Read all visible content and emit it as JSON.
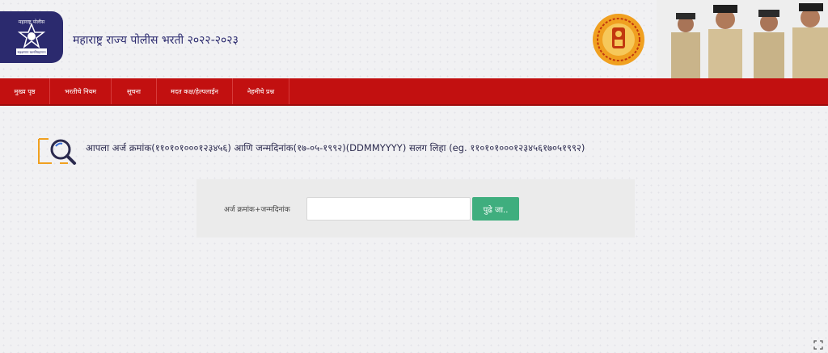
{
  "header": {
    "site_title": "महाराष्ट्र राज्य पोलीस भरती २०२२-२०२३",
    "logo_text_top": "महाराष्ट्र पोलीस",
    "logo_text_bottom": "सद्रक्षणाय खलनिग्रहणाय"
  },
  "nav": {
    "items": [
      {
        "label": "मुख्य पृष्ठ"
      },
      {
        "label": "भरतीचे नियम"
      },
      {
        "label": "सूचना"
      },
      {
        "label": "मदत कक्ष/हेल्पलाईन"
      },
      {
        "label": "नेहमीचे प्रश्न"
      }
    ]
  },
  "instruction": {
    "text": "आपला अर्ज क्रमांक(११०१०१०००१२३४५६) आणि जन्मदिनांक(१७-०५-१९९२)(DDMMYYYY) सलग लिहा (eg. ११०१०१०००१२३४५६१७०५१९९२)"
  },
  "form": {
    "field_label": "अर्ज क्रमांक+जन्मदिनांक",
    "input_value": "",
    "input_placeholder": "",
    "submit_label": "पुढे जा.."
  },
  "colors": {
    "navbar": "#c21010",
    "logo_bg": "#2b2a6e",
    "button": "#3fae7e",
    "emblem": "#f0a020"
  },
  "icons": {
    "instruction": "search-document-icon",
    "corner": "expand-icon"
  }
}
